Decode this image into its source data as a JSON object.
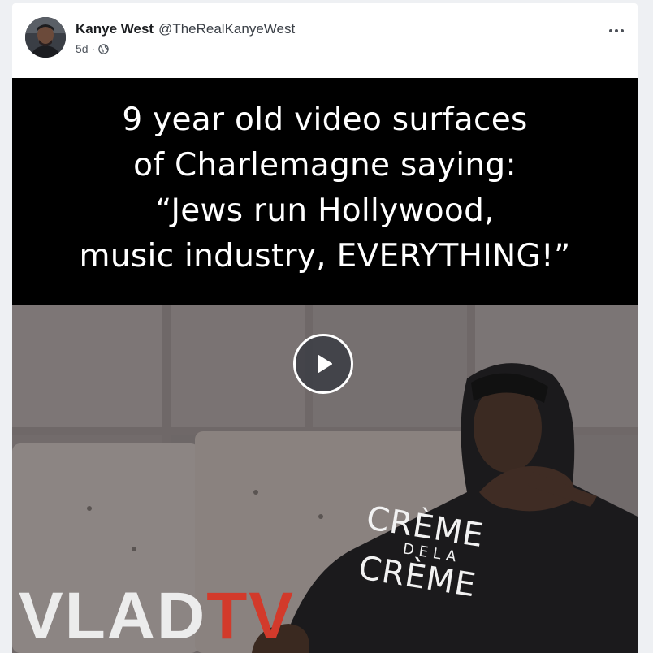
{
  "post": {
    "author_name": "Kanye West",
    "author_handle": "@TheRealKanyeWest",
    "time_ago": "5d",
    "separator": "·",
    "visibility_icon": "globe-icon",
    "more_icon": "more-horizontal-icon",
    "avatar_icon": "avatar"
  },
  "video": {
    "caption": "9 year old video surfaces\nof Charlemagne saying:\n“Jews run Hollywood,\nmusic industry, EVERYTHING!”",
    "play_icon": "play-icon",
    "watermark_part1": "VLAD",
    "watermark_part2": "TV",
    "shirt_line1": "CRÈME",
    "shirt_line2": "DELA",
    "shirt_line3": "CRÈME"
  },
  "colors": {
    "page_bg": "#eef0f3",
    "card_bg": "#ffffff",
    "watermark_red": "#d23a2b"
  }
}
